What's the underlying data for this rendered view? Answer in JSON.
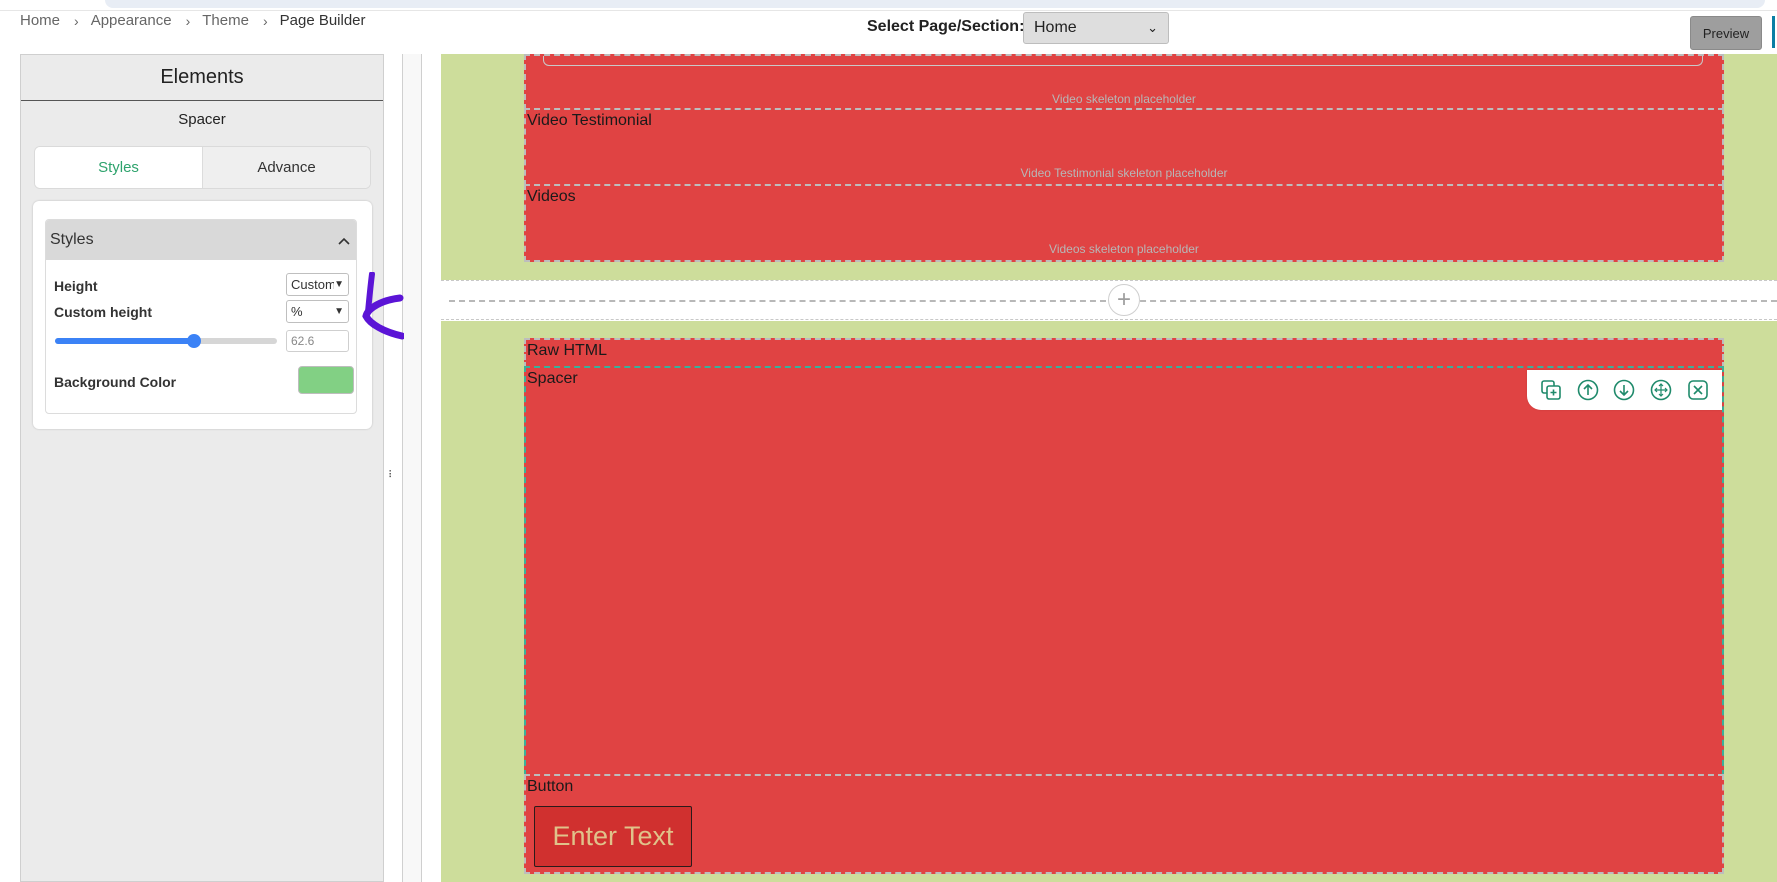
{
  "breadcrumb": [
    "Home",
    "Appearance",
    "Theme",
    "Page Builder"
  ],
  "header": {
    "select_label": "Select Page/Section:",
    "select_value": "Home",
    "preview_label": "Preview"
  },
  "panel": {
    "title": "Elements",
    "subtitle": "Spacer",
    "tabs": [
      "Styles",
      "Advance"
    ],
    "section_title": "Styles",
    "height_label": "Height",
    "height_value": "Custom",
    "custom_height_label": "Custom height",
    "unit_value": "%",
    "slider_value": 62.6,
    "slider_text": "62.6",
    "background_label": "Background Color",
    "background_color": "#82d084"
  },
  "canvas": {
    "sections_top": [
      {
        "label": "",
        "placeholder": "Video skeleton placeholder"
      },
      {
        "label": "Video Testimonial",
        "placeholder": "Video Testimonial skeleton placeholder"
      },
      {
        "label": "Videos",
        "placeholder": "Videos skeleton placeholder"
      }
    ],
    "raw_html_label": "Raw HTML",
    "spacer_label": "Spacer",
    "button_label": "Button",
    "button_text": "Enter Text"
  },
  "icons": {
    "chevron": "chevron-right-icon",
    "plus": "plus-icon",
    "toolbar": [
      "duplicate-icon",
      "move-up-icon",
      "move-down-icon",
      "drag-move-icon",
      "close-icon"
    ]
  },
  "colors": {
    "section_green": "#cddd9b",
    "element_red": "#e04343",
    "accent_green": "#2ea36d",
    "slider_blue": "#3b82f6",
    "annotation_purple": "#5b14d6"
  }
}
